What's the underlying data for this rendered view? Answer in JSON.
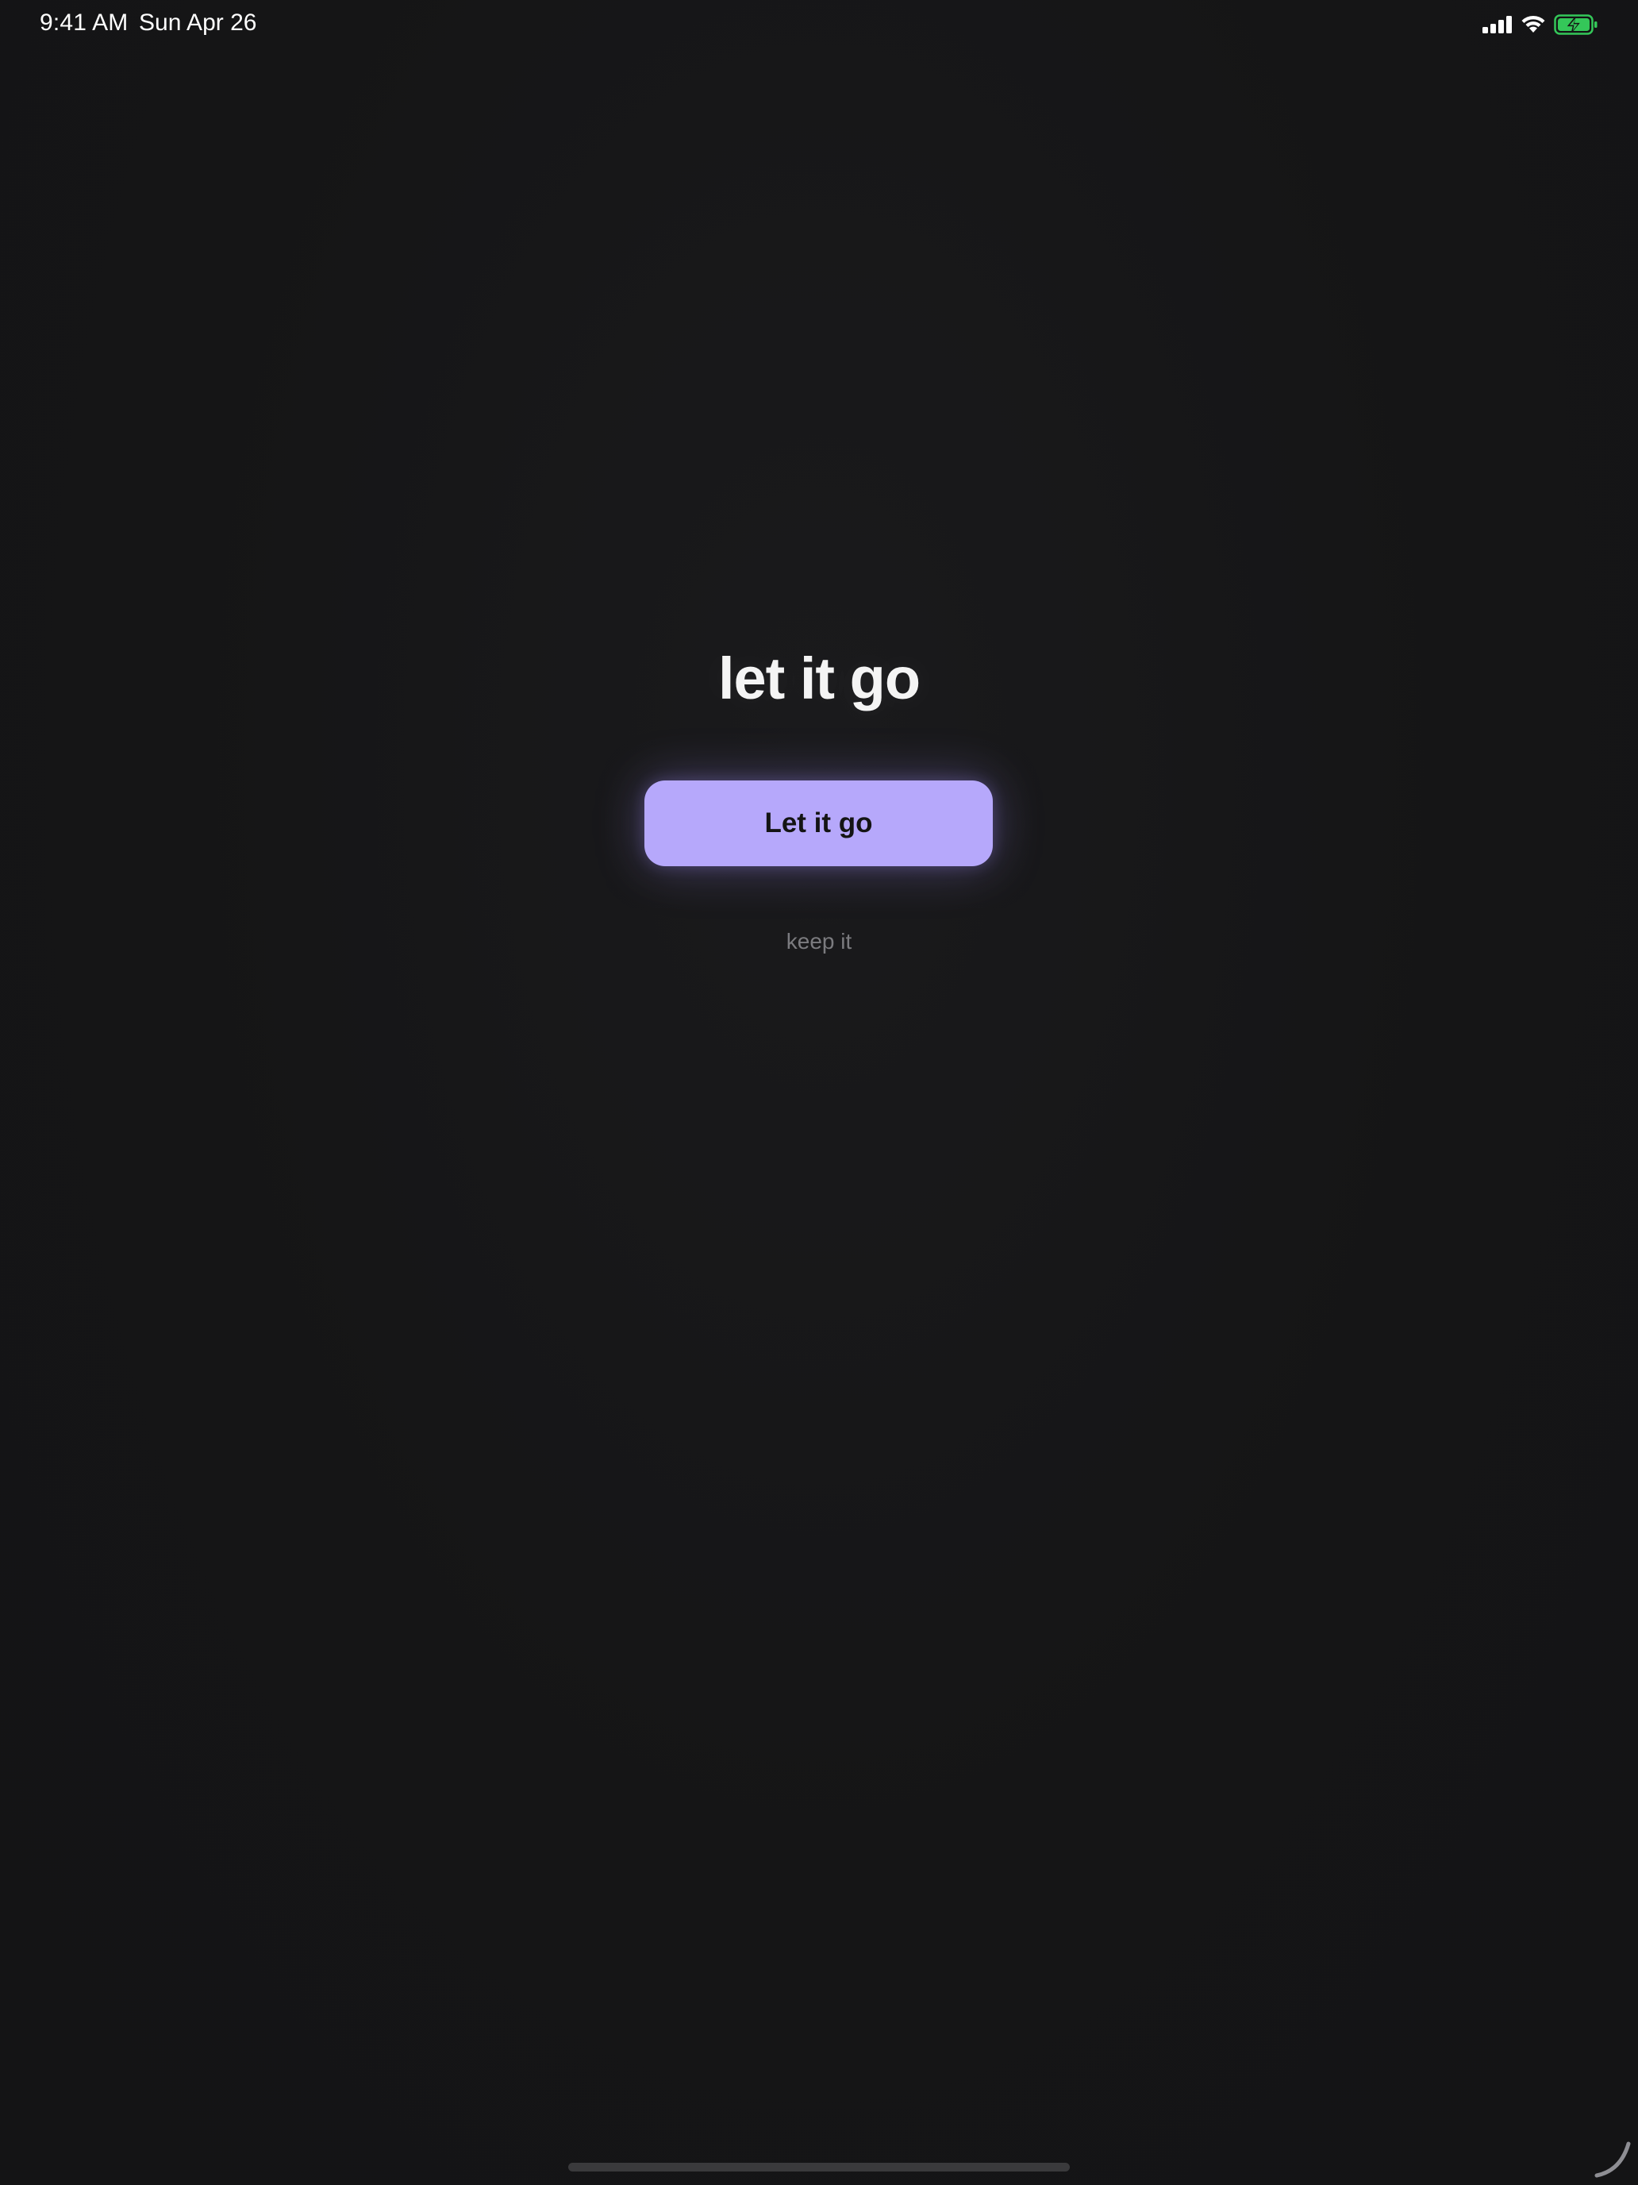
{
  "status_bar": {
    "time": "9:41 AM",
    "date": "Sun Apr 26",
    "icons": [
      "cellular-signal-icon",
      "wifi-icon",
      "battery-charging-icon"
    ],
    "battery_color": "#34c759"
  },
  "main": {
    "headline": "let it go",
    "primary_button_label": "Let it go",
    "secondary_label": "keep it"
  },
  "colors": {
    "background": "#151516",
    "accent": "#b6a8fb",
    "secondary_text": "#7b7b7f"
  }
}
